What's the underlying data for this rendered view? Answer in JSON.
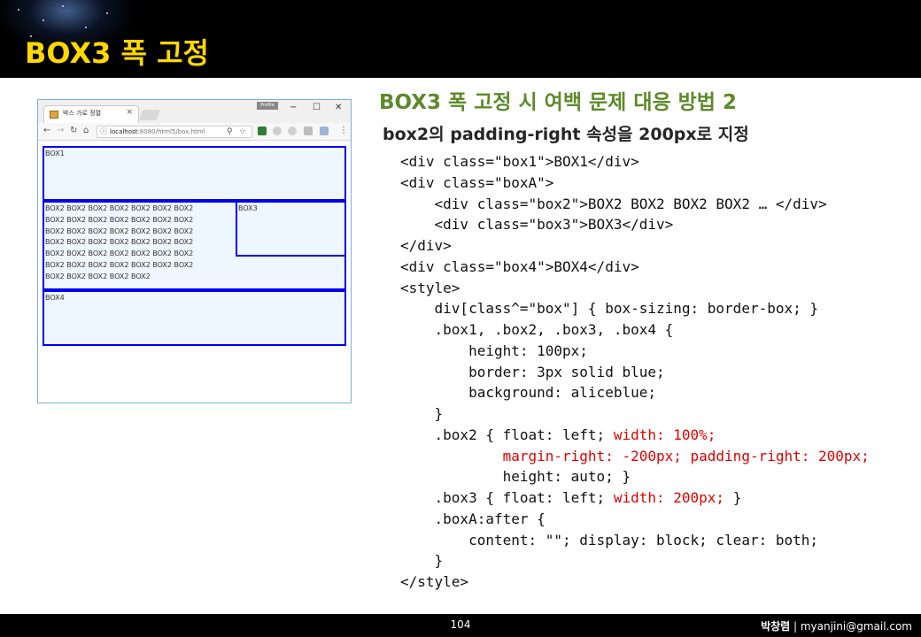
{
  "slide_title": "BOX3 폭 고정",
  "heading": "BOX3 폭 고정 시 여백 문제 대응 방법 2",
  "subheading": "box2의 padding-right 속성을 200px로 지정",
  "browser": {
    "tab_title": "박스 가로 정렬",
    "tab_close": "×",
    "profile_label": "Profile",
    "window_controls": {
      "minimize": "−",
      "maximize": "☐",
      "close": "✕"
    },
    "nav": {
      "back": "←",
      "forward": "→",
      "reload": "↻",
      "home": "⌂"
    },
    "url_host": "localhost",
    "url_rest": ":8080/html5/box.html",
    "menu": "⋮",
    "demo": {
      "box1": "BOX1",
      "box2_lines": [
        "BOX2 BOX2 BOX2 BOX2 BOX2 BOX2 BOX2",
        "BOX2 BOX2 BOX2 BOX2 BOX2 BOX2 BOX2",
        "BOX2 BOX2 BOX2 BOX2 BOX2 BOX2 BOX2",
        "BOX2 BOX2 BOX2 BOX2 BOX2 BOX2 BOX2",
        "BOX2 BOX2 BOX2 BOX2 BOX2 BOX2 BOX2",
        "BOX2 BOX2 BOX2 BOX2 BOX2 BOX2 BOX2",
        "BOX2 BOX2 BOX2 BOX2 BOX2"
      ],
      "box3": "BOX3",
      "box4": "BOX4"
    }
  },
  "code_lines": [
    [
      {
        "t": "<div class=\"box1\">BOX1</div>"
      }
    ],
    [
      {
        "t": "<div class=\"boxA\">"
      }
    ],
    [
      {
        "t": "    <div class=\"box2\">BOX2 BOX2 BOX2 BOX2 … </div>"
      }
    ],
    [
      {
        "t": "    <div class=\"box3\">BOX3</div>"
      }
    ],
    [
      {
        "t": "</div>"
      }
    ],
    [
      {
        "t": "<div class=\"box4\">BOX4</div>"
      }
    ],
    [
      {
        "t": "<style>"
      }
    ],
    [
      {
        "t": "    div[class^=\"box\"] { box-sizing: border-box; }"
      }
    ],
    [
      {
        "t": "    .box1, .box2, .box3, .box4 {"
      }
    ],
    [
      {
        "t": "        height: 100px;"
      }
    ],
    [
      {
        "t": "        border: 3px solid blue;"
      }
    ],
    [
      {
        "t": "        background: aliceblue;"
      }
    ],
    [
      {
        "t": "    }"
      }
    ],
    [
      {
        "t": "    .box2 { float: left; "
      },
      {
        "t": "width: 100%;",
        "red": true
      }
    ],
    [
      {
        "t": "            "
      },
      {
        "t": "margin-right: -200px; padding-right: 200px;",
        "red": true
      }
    ],
    [
      {
        "t": "            height: auto; }"
      }
    ],
    [
      {
        "t": "    .box3 { float: left; "
      },
      {
        "t": "width: 200px;",
        "red": true
      },
      {
        "t": " }"
      }
    ],
    [
      {
        "t": "    .boxA:after {"
      }
    ],
    [
      {
        "t": "        content: \"\"; display: block; clear: both;"
      }
    ],
    [
      {
        "t": "    }"
      }
    ],
    [
      {
        "t": "</style>"
      }
    ]
  ],
  "footer": {
    "page_number": "104",
    "author_name": "박창렴",
    "author_sep": " | ",
    "author_email": "myanjini@gmail.com"
  },
  "colors": {
    "title": "#ffd800",
    "heading": "#5d8a2a",
    "highlight": "#e00000",
    "demo_border": "#0000ee",
    "demo_bg": "#eef6ff"
  }
}
